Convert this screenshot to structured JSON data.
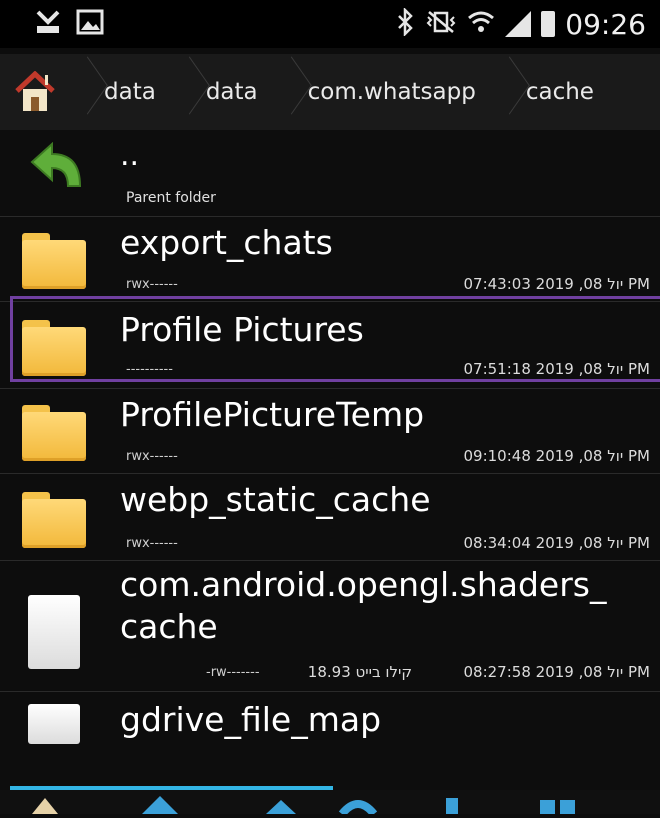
{
  "status_bar": {
    "time": "09:26",
    "icons": [
      "usb-debug-icon",
      "image-notification-icon",
      "bluetooth-icon",
      "vibrate-icon",
      "wifi-icon",
      "signal-icon",
      "battery-icon"
    ]
  },
  "breadcrumb": {
    "items": [
      "data",
      "data",
      "com.whatsapp",
      "cache"
    ]
  },
  "list": {
    "parent": {
      "name": "..",
      "label": "Parent folder"
    },
    "items": [
      {
        "name": "export_chats",
        "perms": "rwx------",
        "date": "יול 08, 2019 07:43:03 PM",
        "type": "folder"
      },
      {
        "name": "Profile Pictures",
        "perms": "----------",
        "date": "יול 08, 2019 07:51:18 PM",
        "type": "folder"
      },
      {
        "name": "ProfilePictureTemp",
        "perms": "rwx------",
        "date": "יול 08, 2019 09:10:48 PM",
        "type": "folder"
      },
      {
        "name": "webp_static_cache",
        "perms": "rwx------",
        "date": "יול 08, 2019 08:34:04 PM",
        "type": "folder"
      },
      {
        "name_line1": "com.android.opengl.shaders_",
        "name_line2": "cache",
        "perms": "-rw-------",
        "size": "18.93 קילו בייט",
        "date": "יול 08, 2019 08:27:58 PM",
        "type": "file"
      },
      {
        "name": "gdrive_file_map",
        "type": "file"
      }
    ]
  },
  "colors": {
    "accent": "#33b5e5",
    "highlight": "#7040a0",
    "folder": "#f2b83a"
  }
}
